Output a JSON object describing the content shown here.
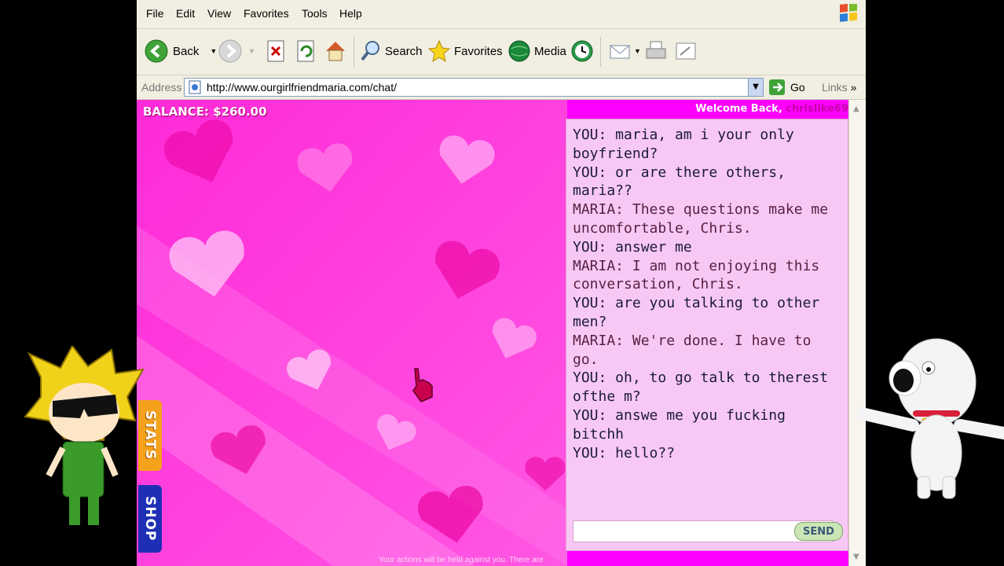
{
  "menu": [
    "File",
    "Edit",
    "View",
    "Favorites",
    "Tools",
    "Help"
  ],
  "toolbar": {
    "back": "Back",
    "search": "Search",
    "favorites": "Favorites",
    "media": "Media"
  },
  "address": {
    "label": "Address",
    "url": "http://www.ourgirlfriendmaria.com/chat/",
    "go": "Go",
    "links": "Links"
  },
  "page": {
    "balance": "BALANCE: $260.00",
    "welcome": "Welcome Back,",
    "username": "chrislike69",
    "tab_stats": "STATS",
    "tab_shop": "SHOP",
    "send": "SEND",
    "footer": "Your actions will be held against you. There are"
  },
  "chat": [
    {
      "speaker": "YOU",
      "text": "YOU: maria, am i your only boyfriend?"
    },
    {
      "speaker": "YOU",
      "text": "YOU: or are there others, maria??"
    },
    {
      "speaker": "MARIA",
      "text": "MARIA: These questions make me uncomfortable, Chris."
    },
    {
      "speaker": "YOU",
      "text": "YOU: answer me"
    },
    {
      "speaker": "MARIA",
      "text": "MARIA: I am not enjoying this conversation, Chris."
    },
    {
      "speaker": "YOU",
      "text": "YOU: are you talking to other men?"
    },
    {
      "speaker": "MARIA",
      "text": "MARIA: We're done. I have to go."
    },
    {
      "speaker": "YOU",
      "text": "YOU: oh, to go talk to therest ofthe m?"
    },
    {
      "speaker": "YOU",
      "text": "YOU: answe me you fucking bitchh"
    },
    {
      "speaker": "YOU",
      "text": "YOU: hello??"
    }
  ],
  "colors": {
    "page_bg": "#000000",
    "chrome": "#ece9d8",
    "pink_bg": "#ff00ff",
    "chat_bg": "#f8c8f5",
    "stats_tab": "#f4a21b",
    "shop_tab": "#1f2fb5"
  }
}
